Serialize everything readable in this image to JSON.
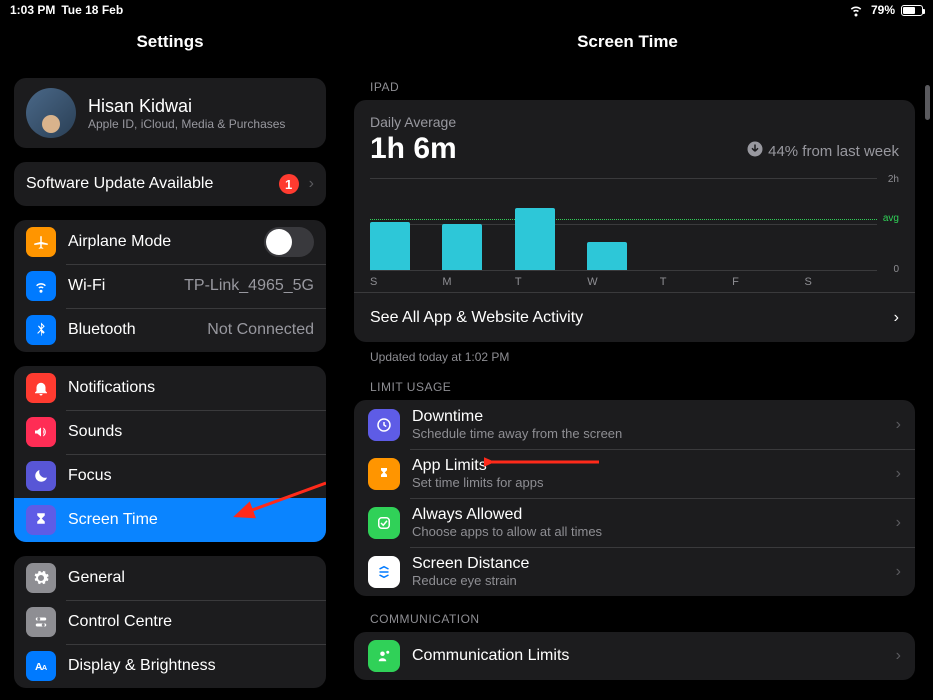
{
  "status": {
    "time": "1:03 PM",
    "date": "Tue 18 Feb",
    "battery_pct": "79%"
  },
  "sidebar": {
    "title": "Settings",
    "profile": {
      "name": "Hisan Kidwai",
      "sub": "Apple ID, iCloud, Media & Purchases"
    },
    "software_update": {
      "label": "Software Update Available",
      "count": "1"
    },
    "airplane": "Airplane Mode",
    "wifi": {
      "label": "Wi-Fi",
      "value": "TP-Link_4965_5G"
    },
    "bluetooth": {
      "label": "Bluetooth",
      "value": "Not Connected"
    },
    "notifications": "Notifications",
    "sounds": "Sounds",
    "focus": "Focus",
    "screentime": "Screen Time",
    "general": "General",
    "control_centre": "Control Centre",
    "display": "Display & Brightness"
  },
  "main": {
    "title": "Screen Time",
    "device_label": "IPAD",
    "daily_avg_label": "Daily Average",
    "daily_avg_value": "1h 6m",
    "delta": "44% from last week",
    "see_all": "See All App & Website Activity",
    "updated": "Updated today at 1:02 PM",
    "limit_header": "LIMIT USAGE",
    "limits": {
      "downtime": {
        "t": "Downtime",
        "s": "Schedule time away from the screen"
      },
      "applimits": {
        "t": "App Limits",
        "s": "Set time limits for apps"
      },
      "always": {
        "t": "Always Allowed",
        "s": "Choose apps to allow at all times"
      },
      "distance": {
        "t": "Screen Distance",
        "s": "Reduce eye strain"
      }
    },
    "comm_header": "COMMUNICATION",
    "comm_limits": "Communication Limits"
  },
  "chart_data": {
    "type": "bar",
    "categories": [
      "S",
      "M",
      "T",
      "W",
      "T",
      "F",
      "S"
    ],
    "values": [
      1.05,
      1.0,
      1.35,
      0.6,
      0,
      0,
      0
    ],
    "ylabel": "",
    "xlabel": "",
    "ylim": [
      0,
      2
    ],
    "avg": 1.1,
    "axis_ticks": {
      "top": "2h",
      "bottom": "0",
      "avg": "avg"
    },
    "title": "Daily Average Screen Time"
  },
  "colors": {
    "orange": "#ff9500",
    "blue": "#007aff",
    "red": "#ff3b30",
    "pink": "#ff2d55",
    "indigo": "#5856d6",
    "icon_indigo": "#5e5ce6",
    "grey": "#8e8e93",
    "green": "#30d158",
    "white": "#ffffff"
  }
}
